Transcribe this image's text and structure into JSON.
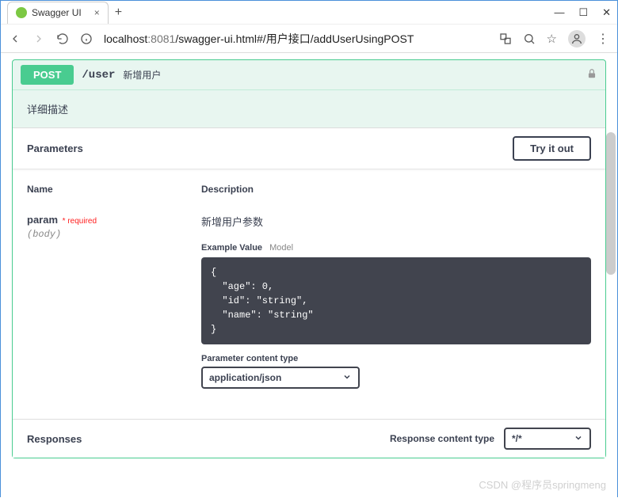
{
  "browser": {
    "tab_title": "Swagger UI",
    "url_host": "localhost",
    "url_port": ":8081",
    "url_path": "/swagger-ui.html#/用户接口/addUserUsingPOST"
  },
  "op": {
    "method": "POST",
    "path": "/user",
    "summary": "新增用户",
    "description": "详细描述"
  },
  "sections": {
    "parameters_title": "Parameters",
    "try_it_out": "Try it out",
    "responses_title": "Responses",
    "col_name": "Name",
    "col_desc": "Description"
  },
  "param": {
    "name": "param",
    "required_label": "* required",
    "location": "(body)",
    "description": "新增用户参数",
    "tab_example": "Example Value",
    "tab_model": "Model",
    "example_code": "{\n  \"age\": 0,\n  \"id\": \"string\",\n  \"name\": \"string\"\n}",
    "content_type_label": "Parameter content type",
    "content_type_value": "application/json"
  },
  "response": {
    "content_type_label": "Response content type",
    "content_type_value": "*/*"
  },
  "watermark": "CSDN @程序员springmeng"
}
